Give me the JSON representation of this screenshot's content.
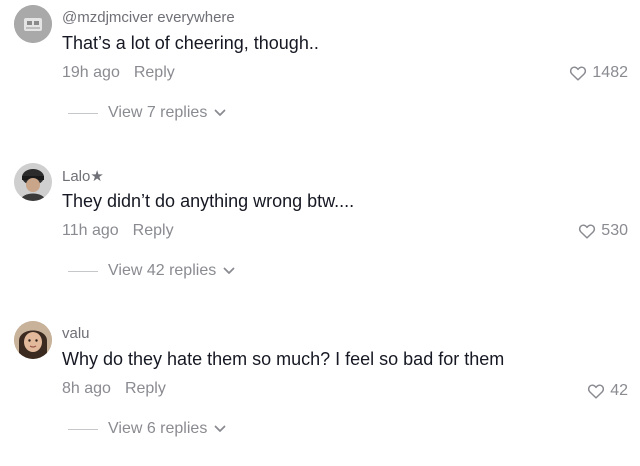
{
  "comments": [
    {
      "username": "@mzdjmciver everywhere",
      "text": "That’s a lot of cheering, though..",
      "time": "19h ago",
      "reply_label": "Reply",
      "likes": "1482",
      "view_replies": "View 7 replies"
    },
    {
      "username": "Lalo★",
      "text": "They didn’t do anything wrong btw....",
      "time": "11h ago",
      "reply_label": "Reply",
      "likes": "530",
      "view_replies": "View 42 replies"
    },
    {
      "username": "valu",
      "text": "Why do they hate them so much? I feel so bad for them",
      "time": "8h ago",
      "reply_label": "Reply",
      "likes": "42",
      "view_replies": "View 6 replies"
    }
  ],
  "icons": {
    "like": "heart-outline-icon",
    "expand": "chevron-down-icon"
  },
  "colors": {
    "primary_text": "#161823",
    "secondary_text": "#8a8b91",
    "username_text": "#6f7077"
  }
}
